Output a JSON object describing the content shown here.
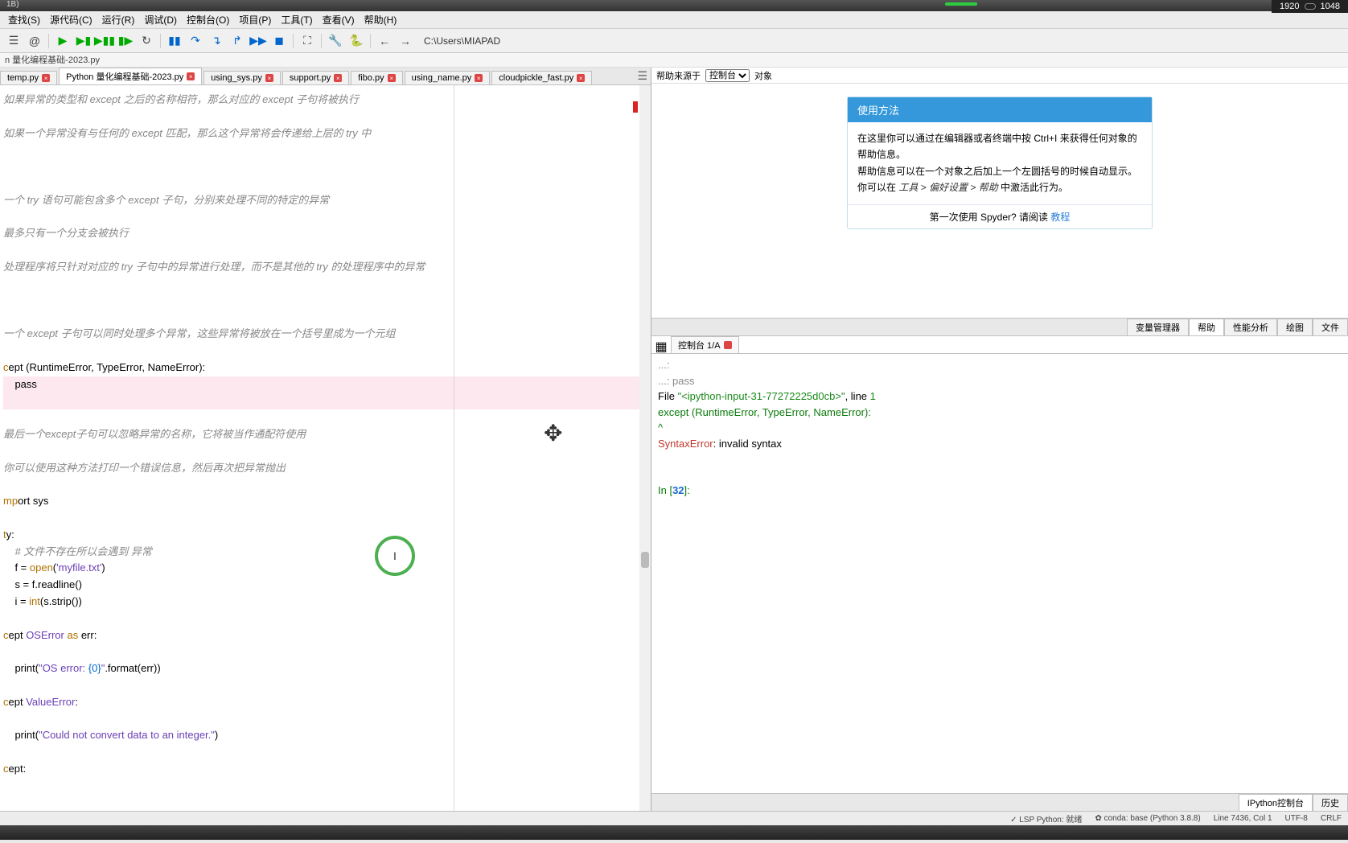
{
  "top_tab": "1B)",
  "resolution": {
    "w": "1920",
    "h": "1048"
  },
  "menu": [
    "查找(S)",
    "源代码(C)",
    "运行(R)",
    "调试(D)",
    "控制台(O)",
    "项目(P)",
    "工具(T)",
    "查看(V)",
    "帮助(H)"
  ],
  "cwd": "C:\\Users\\MIAPAD",
  "file_bar": "n 量化编程基础-2023.py",
  "tabs": [
    {
      "label": "temp.py",
      "active": false
    },
    {
      "label": "Python 量化编程基础-2023.py",
      "active": true
    },
    {
      "label": "using_sys.py",
      "active": false
    },
    {
      "label": "support.py",
      "active": false
    },
    {
      "label": "fibo.py",
      "active": false
    },
    {
      "label": "using_name.py",
      "active": false
    },
    {
      "label": "cloudpickle_fast.py",
      "active": false
    }
  ],
  "code": {
    "c1": "如果异常的类型和 except 之后的名称相符，那么对应的 except 子句将被执行",
    "c2": "如果一个异常没有与任何的 except 匹配，那么这个异常将会传递给上层的 try 中",
    "c3": "一个 try 语句可能包含多个 except 子句，分别来处理不同的特定的异常",
    "c4": "最多只有一个分支会被执行",
    "c5": "处理程序将只针对对应的 try 子句中的异常进行处理，而不是其他的 try 的处理程序中的异常",
    "c6": "一个 except 子句可以同时处理多个异常，这些异常将被放在一个括号里成为一个元组",
    "ex1": "ept (RuntimeError, TypeError, NameError):",
    "pass": "    pass",
    "c7": "最后一个except子句可以忽略异常的名称，它将被当作通配符使用",
    "c8": "你可以使用这种方法打印一个错误信息，然后再次把异常抛出",
    "imp": "ort sys",
    "try": "y:",
    "cfile": "    # 文件不存在所以会遇到 异常",
    "f1": "    f = open('myfile.txt')",
    "f2": "    s = f.readline()",
    "f3": "    i = int(s.strip())",
    "ex2": "ept OSError as err:",
    "p1a": "    print(",
    "p1str": "\"OS error: ",
    "p1fmt": "{0}",
    "p1end": "\"",
    "p1b": ".format(err))",
    "ex3": "ept ValueError:",
    "p2a": "    print(",
    "p2b": "\"Could not convert data to an integer.\"",
    "p2c": ")",
    "ex4": "ept:"
  },
  "help": {
    "source_label": "帮助来源于",
    "source_value": "控制台",
    "object_label": "对象",
    "title": "使用方法",
    "l1a": "在这里你可以通过在编辑器或者终端中按 ",
    "l1b": "Ctrl+I",
    "l1c": " 来获得任何对象的帮助信息。",
    "l2a": "帮助信息可以在一个对象之后加上一个左圆括号的时候自动显示。你可以在 ",
    "l2b": "工具 > 偏好设置 > 帮助",
    "l2c": " 中激活此行为。",
    "l3a": "第一次使用 Spyder? 请阅读 ",
    "l3b": "教程"
  },
  "panel_tabs": [
    "变量管理器",
    "帮助",
    "性能分析",
    "绘图",
    "文件"
  ],
  "console_tab": "控制台 1/A",
  "console": {
    "dots1": "   ...: ",
    "dots2": "   ...:     pass",
    "file_pre": "  File ",
    "file_q": "\"<ipython-input-31-77272225d0cb>\"",
    "file_post": ", line ",
    "file_ln": "1",
    "exc": "    except (RuntimeError, TypeError, NameError):",
    "caret": "         ^",
    "err": "SyntaxError",
    "errmsg": ": invalid syntax",
    "in_pre": "In [",
    "in_n": "32",
    "in_post": "]: "
  },
  "bottom_tabs": [
    "IPython控制台",
    "历史"
  ],
  "status": {
    "lsp": "✓ LSP Python: 就绪",
    "conda": "✿ conda: base (Python 3.8.8)",
    "line": "Line 7436, Col 1",
    "enc": "UTF-8",
    "eol": "CRLF"
  }
}
